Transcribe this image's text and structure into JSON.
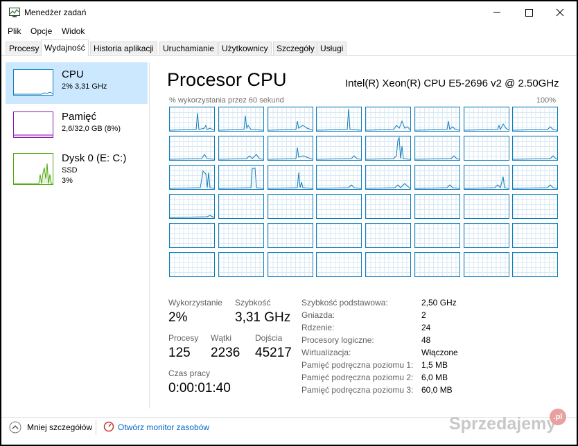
{
  "window": {
    "title": "Menedżer zadań"
  },
  "menu": [
    "Plik",
    "Opcje",
    "Widok"
  ],
  "tabs": [
    "Procesy",
    "Wydajność",
    "Historia aplikacji",
    "Uruchamianie",
    "Użytkownicy",
    "Szczegóły",
    "Usługi"
  ],
  "active_tab": "Wydajność",
  "sidebar": {
    "items": [
      {
        "name": "CPU",
        "sub1": "2% 3,31 GHz",
        "sub2": "",
        "sub3": "",
        "color": "#117dbb"
      },
      {
        "name": "Pamięć",
        "sub1": "2,6/32,0 GB (8%)",
        "sub2": "",
        "sub3": "",
        "color": "#8b12ae"
      },
      {
        "name": "Dysk 0 (E: C:)",
        "sub1": "SSD",
        "sub2": "3%",
        "sub3": "",
        "color": "#4da60c"
      }
    ]
  },
  "main": {
    "title": "Procesor CPU",
    "model": "Intel(R) Xeon(R) CPU E5-2696 v2 @ 2.50GHz",
    "graph_label": "% wykorzystania przez 60 sekund",
    "graph_max": "100%"
  },
  "stats": {
    "utilization_label": "Wykorzystanie",
    "utilization": "2%",
    "speed_label": "Szybkość",
    "speed": "3,31 GHz",
    "processes_label": "Procesy",
    "processes": "125",
    "threads_label": "Wątki",
    "threads": "2236",
    "handles_label": "Dojścia",
    "handles": "45217",
    "uptime_label": "Czas pracy",
    "uptime": "0:00:01:40"
  },
  "specs": [
    {
      "label": "Szybkość podstawowa:",
      "value": "2,50 GHz"
    },
    {
      "label": "Gniazda:",
      "value": "2"
    },
    {
      "label": "Rdzenie:",
      "value": "24"
    },
    {
      "label": "Procesory logiczne:",
      "value": "48"
    },
    {
      "label": "Wirtualizacja:",
      "value": "Włączone"
    },
    {
      "label": "Pamięć podręczna poziomu 1:",
      "value": "1,5 MB"
    },
    {
      "label": "Pamięć podręczna poziomu 2:",
      "value": "6,0 MB"
    },
    {
      "label": "Pamięć podręczna poziomu 3:",
      "value": "60,0 MB"
    }
  ],
  "footer": {
    "less_details": "Mniej szczegółów",
    "resource_monitor": "Otwórz monitor zasobów"
  },
  "watermark": {
    "text": "Sprzedajemy",
    "badge": ".pl"
  },
  "colors": {
    "cpu": "#117dbb",
    "selected": "#cce8ff",
    "link": "#0066cc"
  }
}
